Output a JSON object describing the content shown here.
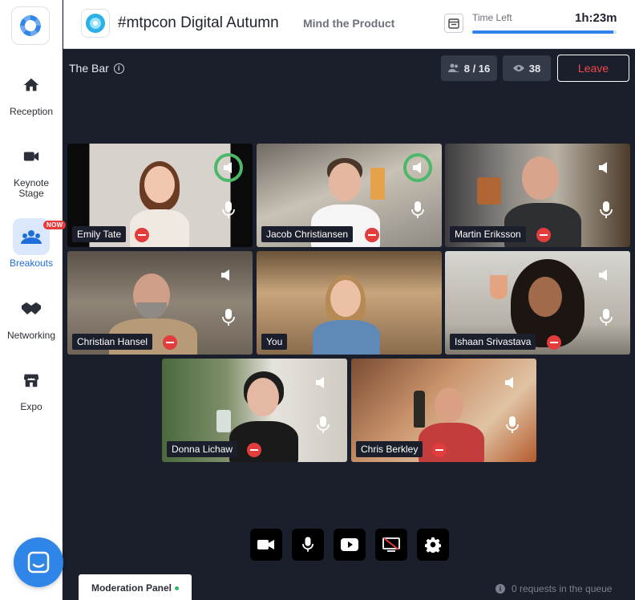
{
  "sidebar": {
    "items": [
      {
        "label": "Reception",
        "icon": "home-icon"
      },
      {
        "label": "Keynote Stage",
        "icon": "video-camera-icon"
      },
      {
        "label": "Breakouts",
        "icon": "group-icon",
        "badge": "NOW",
        "active": true
      },
      {
        "label": "Networking",
        "icon": "handshake-icon"
      },
      {
        "label": "Expo",
        "icon": "storefront-icon"
      }
    ]
  },
  "header": {
    "event_title": "#mtpcon Digital Autumn",
    "organizer": "Mind the Product",
    "time_left_label": "Time Left",
    "time_left_value": "1h:23m",
    "time_progress": 0.98
  },
  "room": {
    "name": "The Bar",
    "participants": "8 / 16",
    "viewers": "38",
    "leave_label": "Leave"
  },
  "participants": [
    {
      "name": "Emily Tate",
      "speaking": true
    },
    {
      "name": "Jacob Christiansen",
      "speaking": true
    },
    {
      "name": "Martin Eriksson",
      "speaking": false
    },
    {
      "name": "Christian Hansel",
      "speaking": false
    },
    {
      "name": "You",
      "speaking": false,
      "self": true
    },
    {
      "name": "Ishaan Srivastava",
      "speaking": false
    },
    {
      "name": "Donna Lichaw",
      "speaking": false
    },
    {
      "name": "Chris Berkley",
      "speaking": false
    }
  ],
  "controls": [
    "camera-icon",
    "microphone-icon",
    "youtube-icon",
    "screen-share-off-icon",
    "settings-icon"
  ],
  "moderation": {
    "tab_label": "Moderation Panel",
    "queue_text": "0 requests in the queue"
  },
  "colors": {
    "accent": "#2f86e8",
    "danger": "#e23c3c",
    "speaking": "#4db86a",
    "stage_bg": "#1b1e2b"
  }
}
